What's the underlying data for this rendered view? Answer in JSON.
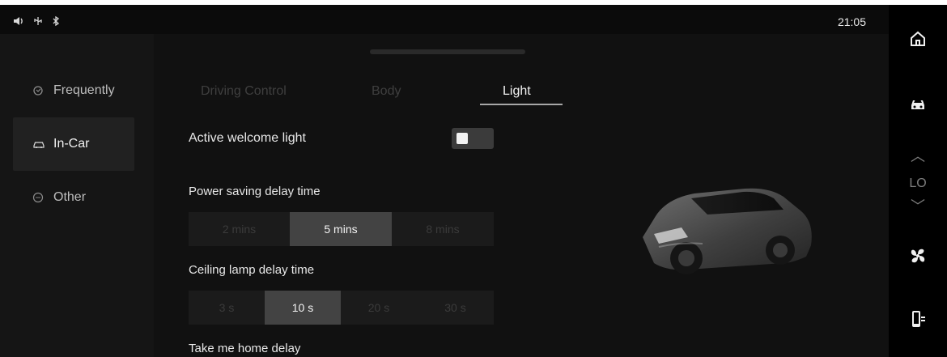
{
  "status": {
    "clock": "21:05",
    "icons": [
      "speaker-icon",
      "usb-icon",
      "bluetooth-icon"
    ]
  },
  "sidebar": {
    "items": [
      {
        "label": "Frequently",
        "icon": "gear-icon"
      },
      {
        "label": "In-Car",
        "icon": "car-outline-icon"
      },
      {
        "label": "Other",
        "icon": "dots-circle-icon"
      }
    ],
    "active_index": 1
  },
  "tabs": [
    {
      "label": "Driving Control"
    },
    {
      "label": "Body"
    },
    {
      "label": "Light"
    }
  ],
  "tabs_active_index": 2,
  "settings": {
    "active_welcome_light": {
      "label": "Active welcome light",
      "enabled": true
    },
    "power_saving_delay": {
      "label": "Power saving delay time",
      "options": [
        "2 mins",
        "5 mins",
        "8 mins"
      ],
      "selected": "5 mins"
    },
    "ceiling_lamp_delay": {
      "label": "Ceiling lamp delay time",
      "options": [
        "3 s",
        "10 s",
        "20 s",
        "30 s"
      ],
      "selected": "10 s"
    },
    "take_me_home": {
      "label": "Take me home delay"
    }
  },
  "right_rail": {
    "temperature": "LO",
    "icons": [
      "home-icon",
      "car-icon",
      "chevron-up-icon",
      "chevron-down-icon",
      "fan-icon",
      "phone-link-icon"
    ]
  },
  "colors": {
    "accent": "#f1f1f1",
    "background": "#111111",
    "panel": "#151515"
  }
}
